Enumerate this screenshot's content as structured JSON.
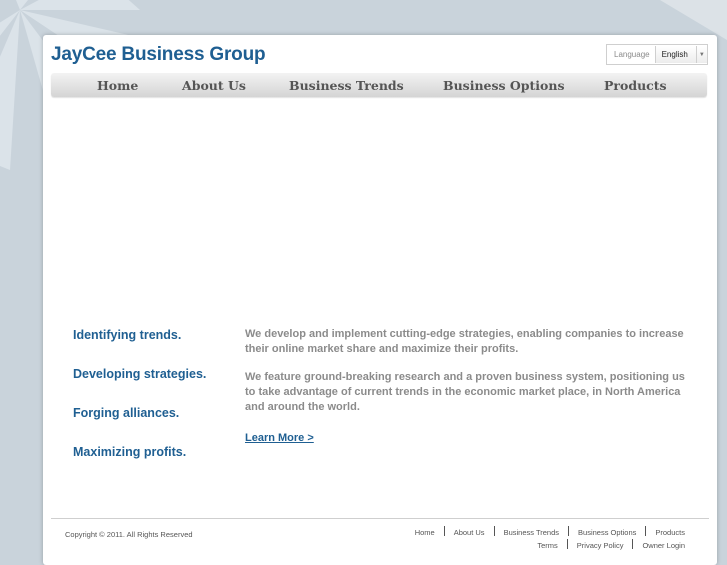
{
  "header": {
    "logo": "JayCee Business Group"
  },
  "language": {
    "label": "Language",
    "selected": "English"
  },
  "nav": {
    "home": "Home",
    "about": "About Us",
    "trends": "Business Trends",
    "options": "Business Options",
    "products": "Products"
  },
  "taglines": [
    "Identifying trends.",
    "Developing strategies.",
    "Forging alliances.",
    "Maximizing profits."
  ],
  "content": {
    "para1": "We develop and implement cutting-edge strategies, enabling companies to increase their online market share and maximize their profits.",
    "para2": "We feature ground-breaking research and a proven business system, positioning us to take advantage of current trends in the economic market place, in North America and around the world.",
    "learn_more": "Learn More >"
  },
  "footer": {
    "copyright": "Copyright © 2011. All Rights Reserved",
    "links": {
      "home": "Home",
      "about": "About Us",
      "trends": "Business Trends",
      "options": "Business Options",
      "products": "Products",
      "terms": "Terms",
      "privacy": "Privacy Policy",
      "owner": "Owner Login"
    }
  }
}
